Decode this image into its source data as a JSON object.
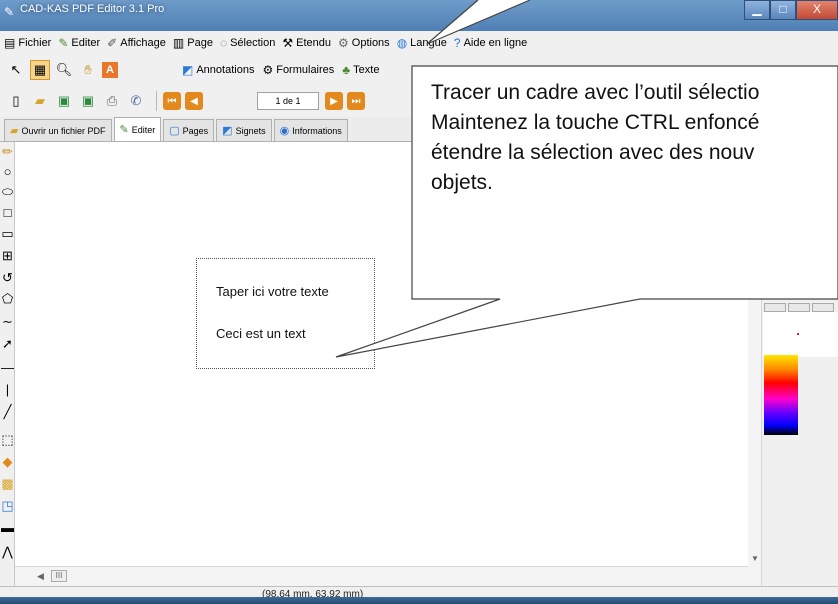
{
  "window": {
    "title": "CAD-KAS PDF Editor 3.1 Pro",
    "controls": {
      "minimize": "▁",
      "maximize": "□",
      "close": "X"
    }
  },
  "menubar": {
    "items": [
      {
        "label": "Fichier",
        "icon": "document-icon"
      },
      {
        "label": "Editer",
        "icon": "brush-icon"
      },
      {
        "label": "Affichage",
        "icon": "pen-icon"
      },
      {
        "label": "Page",
        "icon": "book-icon"
      },
      {
        "label": "Sélection",
        "icon": "lasso-icon"
      },
      {
        "label": "Etendu",
        "icon": "tools-icon"
      },
      {
        "label": "Options",
        "icon": "wrench-icon"
      },
      {
        "label": "Langue",
        "icon": "globe-icon"
      },
      {
        "label": "Aide en ligne",
        "icon": "help-icon"
      }
    ]
  },
  "toolbar1": {
    "items": [
      {
        "label": "Annotations",
        "icon": "annotation-icon"
      },
      {
        "label": "Formulaires",
        "icon": "form-icon"
      },
      {
        "label": "Texte",
        "icon": "text-icon"
      }
    ]
  },
  "toolbar2": {
    "page_indicator": "1 de 1"
  },
  "tabs": [
    {
      "label": "Ouvrir un fichier PDF",
      "icon": "folder-icon"
    },
    {
      "label": "Editer",
      "icon": "brush-icon",
      "active": true
    },
    {
      "label": "Pages",
      "icon": "pages-icon"
    },
    {
      "label": "Signets",
      "icon": "bookmark-icon"
    },
    {
      "label": "Informations",
      "icon": "info-icon"
    }
  ],
  "canvas": {
    "text_line_1": "Taper ici votre texte",
    "text_line_2": "Ceci est un text"
  },
  "callout": {
    "lines": [
      "Tracer un cadre avec l’outil sélectio",
      "Maintenez la touche CTRL enfoncé",
      "étendre la sélection avec des nouv",
      "objets."
    ]
  },
  "status": {
    "coordinates": "(98.64 mm, 63.92 mm)"
  },
  "scrollbar": {
    "grip": "III"
  }
}
